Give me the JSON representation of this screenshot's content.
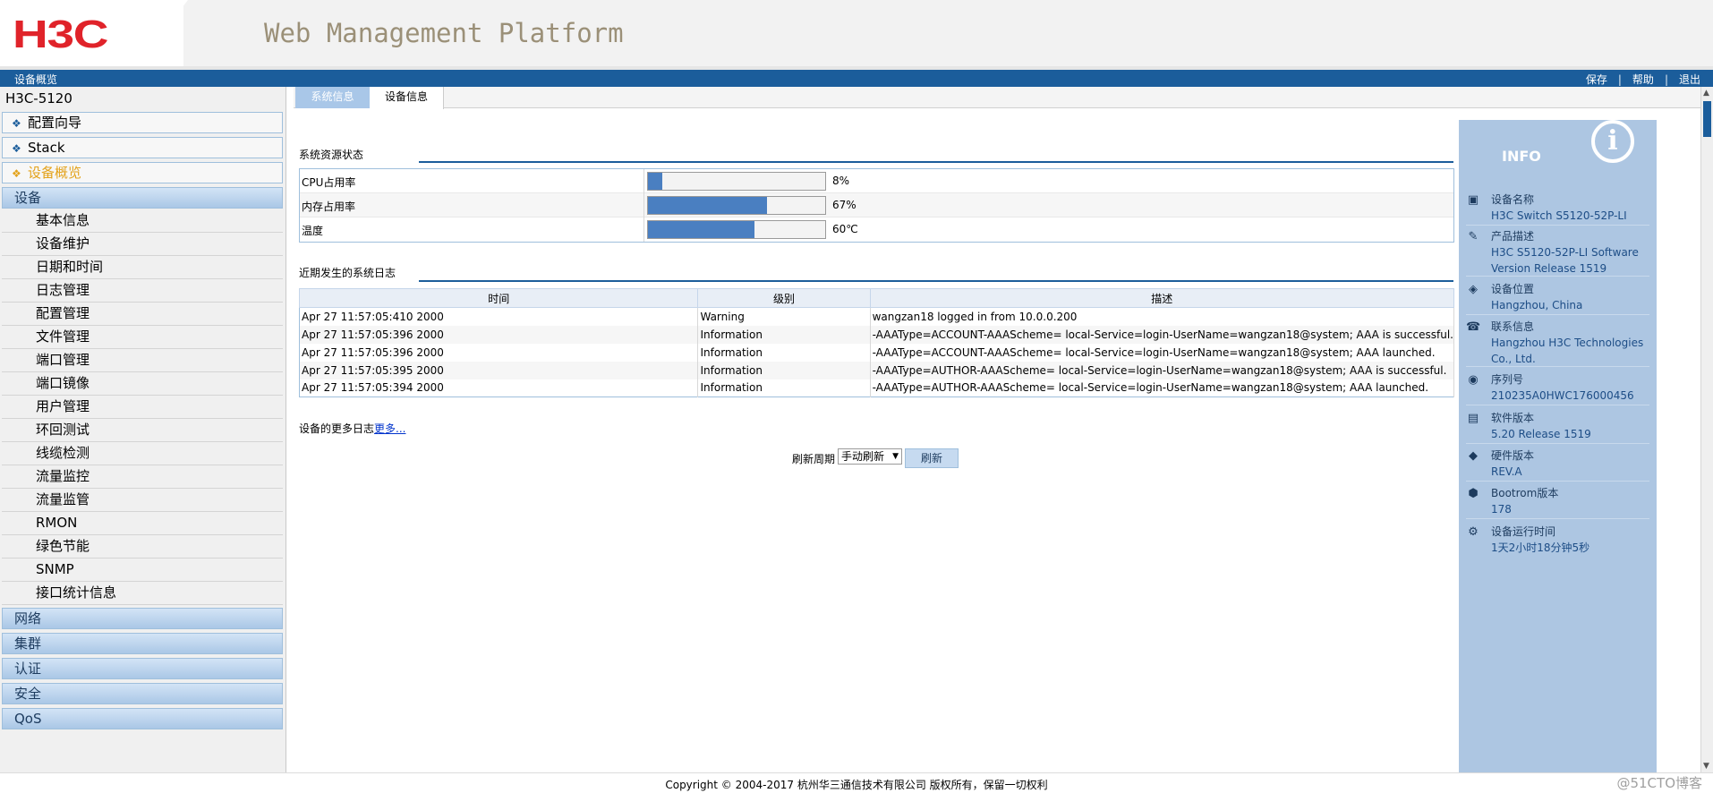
{
  "header": {
    "logo": "H3C",
    "platform_title": "Web Management Platform"
  },
  "topbar": {
    "breadcrumb": "设备概览",
    "links": [
      "保存",
      "帮助",
      "退出"
    ]
  },
  "sidebar": {
    "device_name": "H3C-5120",
    "top_items": [
      "配置向导",
      "Stack",
      "设备概览"
    ],
    "device_group": "设备",
    "sub_items": [
      "基本信息",
      "设备维护",
      "日期和时间",
      "日志管理",
      "配置管理",
      "文件管理",
      "端口管理",
      "端口镜像",
      "用户管理",
      "环回测试",
      "线缆检测",
      "流量监控",
      "流量监管",
      "RMON",
      "绿色节能",
      "SNMP",
      "接口统计信息"
    ],
    "other_groups": [
      "网络",
      "集群",
      "认证",
      "安全",
      "QoS"
    ]
  },
  "tabs": [
    "系统信息",
    "设备信息"
  ],
  "resources": {
    "title": "系统资源状态",
    "rows": [
      {
        "label": "CPU占用率",
        "value_text": "8%",
        "fraction": 0.08
      },
      {
        "label": "内存占用率",
        "value_text": "67%",
        "fraction": 0.67
      },
      {
        "label": "温度",
        "value_text": "60℃",
        "fraction": 0.6
      }
    ]
  },
  "logs": {
    "title": "近期发生的系统日志",
    "headers": [
      "时间",
      "级别",
      "描述"
    ],
    "rows": [
      [
        "Apr 27 11:57:05:410 2000",
        "Warning",
        "wangzan18 logged in from 10.0.0.200"
      ],
      [
        "Apr 27 11:57:05:396 2000",
        "Information",
        "-AAAType=ACCOUNT-AAAScheme= local-Service=login-UserName=wangzan18@system; AAA is successful."
      ],
      [
        "Apr 27 11:57:05:396 2000",
        "Information",
        "-AAAType=ACCOUNT-AAAScheme= local-Service=login-UserName=wangzan18@system; AAA launched."
      ],
      [
        "Apr 27 11:57:05:395 2000",
        "Information",
        "-AAAType=AUTHOR-AAAScheme= local-Service=login-UserName=wangzan18@system; AAA is successful."
      ],
      [
        "Apr 27 11:57:05:394 2000",
        "Information",
        "-AAAType=AUTHOR-AAAScheme= local-Service=login-UserName=wangzan18@system; AAA launched."
      ]
    ],
    "more_prefix": "设备的更多日志",
    "more_link": "更多..."
  },
  "refresh": {
    "label": "刷新周期",
    "selected": "手动刷新",
    "button": "刷新"
  },
  "info": {
    "title": "INFO",
    "items": [
      {
        "key": "设备名称",
        "value": "H3C Switch S5120-52P-LI",
        "icon": "device-icon"
      },
      {
        "key": "产品描述",
        "value": "H3C S5120-52P-LI Software Version Release 1519",
        "icon": "description-icon"
      },
      {
        "key": "设备位置",
        "value": "Hangzhou, China",
        "icon": "location-icon"
      },
      {
        "key": "联系信息",
        "value": "Hangzhou H3C Technologies Co., Ltd.",
        "icon": "contact-icon"
      },
      {
        "key": "序列号",
        "value": "210235A0HWC176000456",
        "icon": "serial-icon"
      },
      {
        "key": "软件版本",
        "value": "5.20 Release 1519",
        "icon": "software-icon"
      },
      {
        "key": "硬件版本",
        "value": "REV.A",
        "icon": "hardware-icon"
      },
      {
        "key": "Bootrom版本",
        "value": "178",
        "icon": "bootrom-icon"
      },
      {
        "key": "设备运行时间",
        "value": "1天2小时18分钟5秒",
        "icon": "uptime-icon"
      }
    ]
  },
  "footer": {
    "copyright": "Copyright © 2004-2017 杭州华三通信技术有限公司 版权所有，保留一切权利",
    "watermark": "@51CTO博客"
  },
  "colors": {
    "brand_red": "#e0232a",
    "topbar_blue": "#1b5d9b",
    "bar_fill": "#4a7fc1",
    "info_panel": "#adc6e2"
  }
}
